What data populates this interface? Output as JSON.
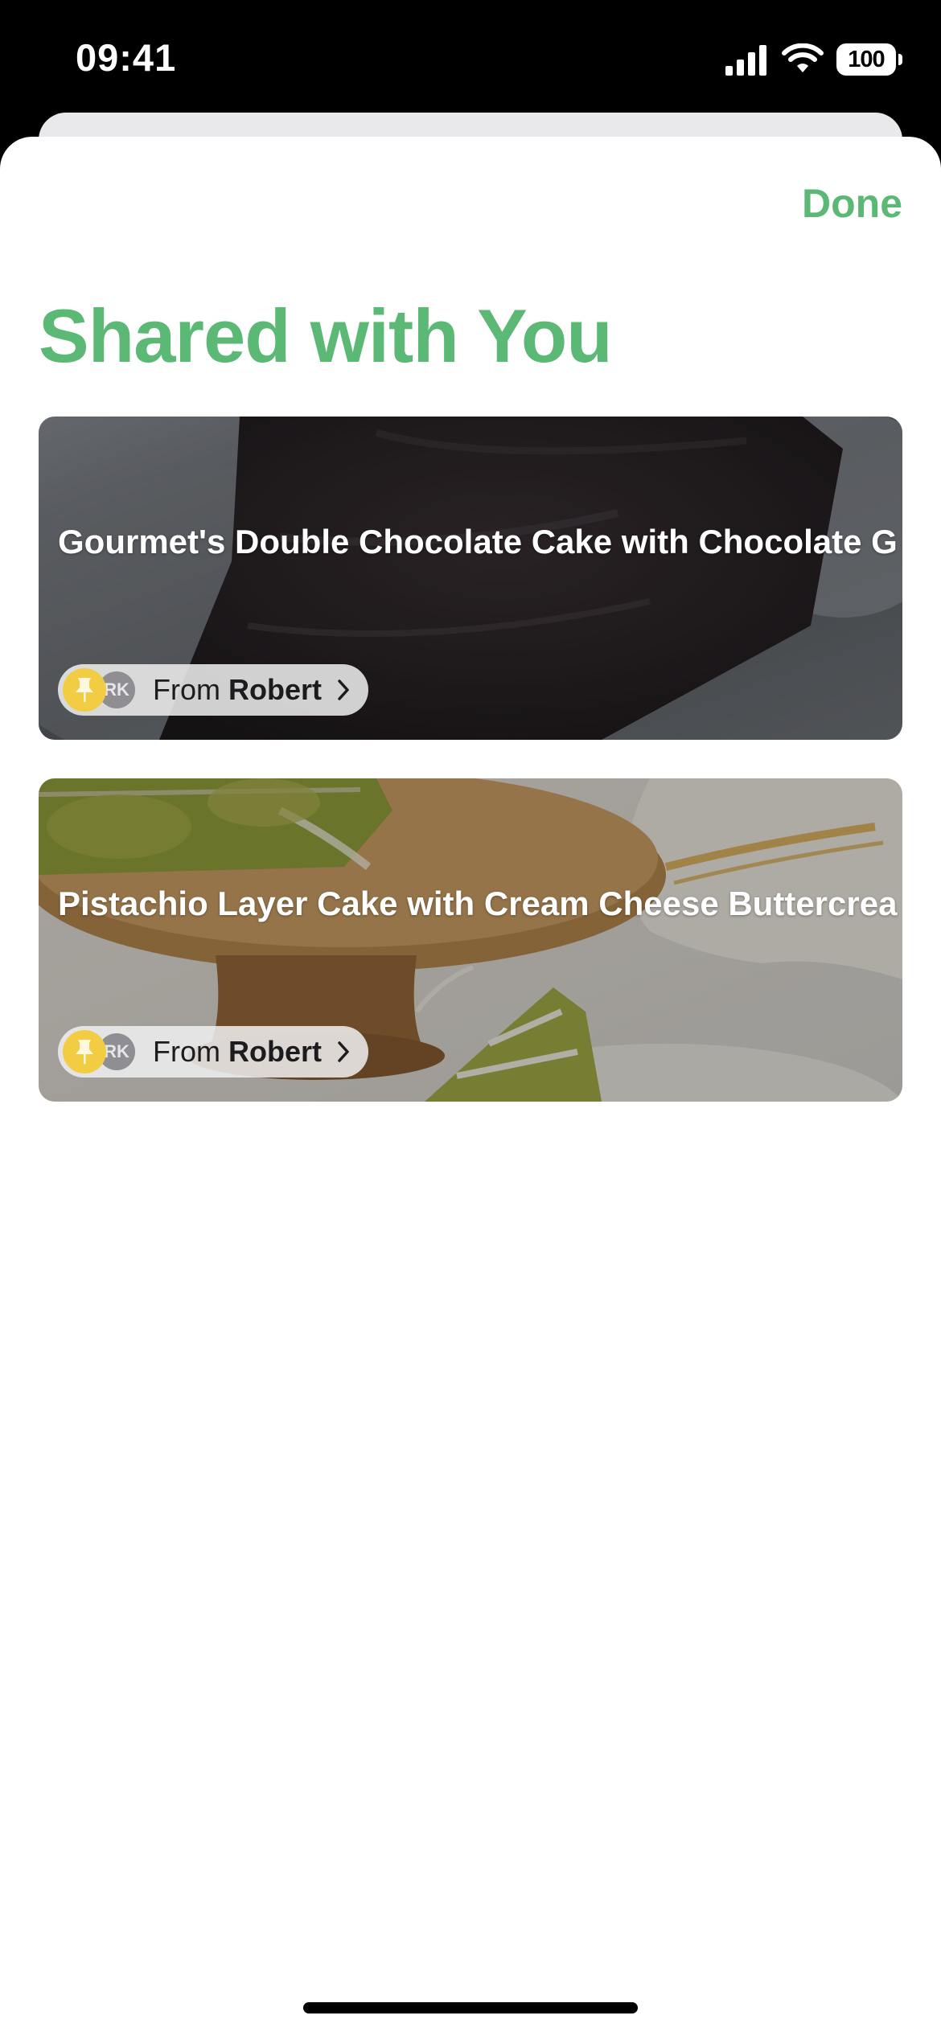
{
  "status_bar": {
    "time": "09:41",
    "battery": "100",
    "icons": [
      "cellular-signal-icon",
      "wifi-icon",
      "battery-icon"
    ]
  },
  "header": {
    "done_label": "Done",
    "title": "Shared with You"
  },
  "cards": [
    {
      "title": "Gourmet's Double Chocolate Cake with Chocolate G",
      "from_prefix": "From ",
      "from_name": "Robert",
      "avatar_initials": "RK",
      "icons": [
        "pin-icon",
        "chevron-right-icon"
      ]
    },
    {
      "title": "Pistachio Layer Cake with Cream Cheese Buttercrea",
      "from_prefix": "From ",
      "from_name": "Robert",
      "avatar_initials": "RK",
      "icons": [
        "pin-icon",
        "chevron-right-icon"
      ]
    }
  ],
  "colors": {
    "accent": "#5cb875",
    "pin_badge": "#f2cd43",
    "avatar": "#8e8e93"
  }
}
